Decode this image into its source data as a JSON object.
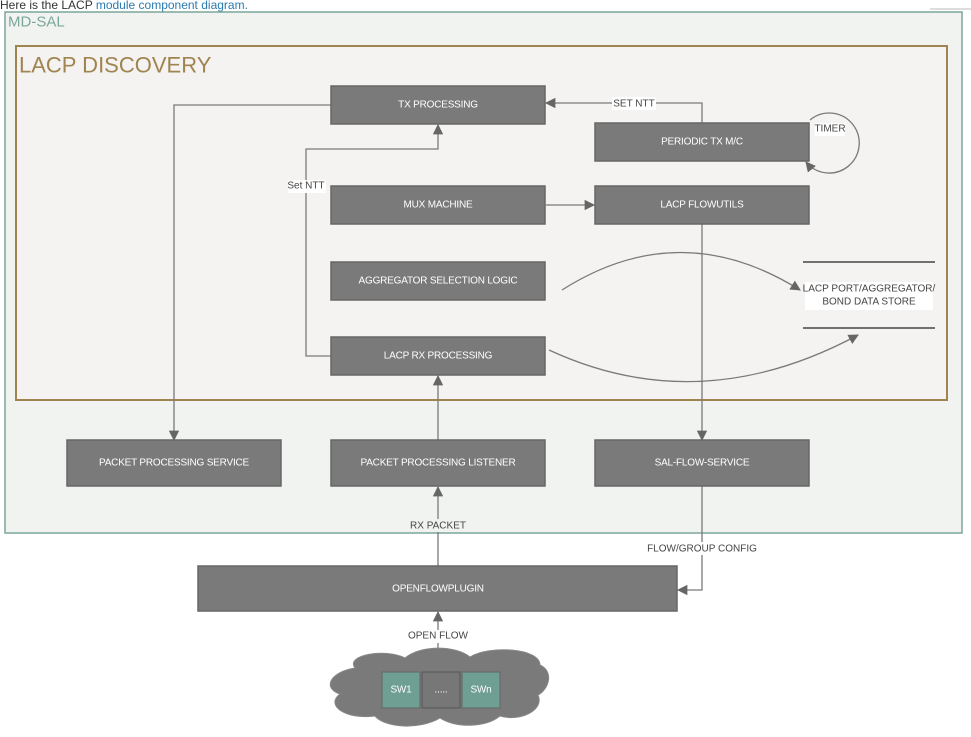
{
  "intro": {
    "prefix": "Here is the LACP ",
    "link": "module component diagram."
  },
  "containers": {
    "outer": "MD-SAL",
    "inner": "LACP DISCOVERY"
  },
  "boxes": {
    "tx": "TX PROCESSING",
    "periodic": "PERIODIC TX M/C",
    "mux": "MUX MACHINE",
    "flowutils": "LACP FLOWUTILS",
    "agg": "AGGREGATOR SELECTION LOGIC",
    "rx": "LACP RX PROCESSING",
    "pps": "PACKET PROCESSING SERVICE",
    "ppl": "PACKET PROCESSING LISTENER",
    "sal": "SAL-FLOW-SERVICE",
    "ofp": "OPENFLOWPLUGIN"
  },
  "datastore": {
    "line1": "LACP PORT/AGGREGATOR/",
    "line2": "BOND DATA STORE"
  },
  "labels": {
    "set_ntt_top": "SET NTT",
    "set_ntt_left": "Set NTT",
    "timer": "TIMER",
    "rx_packet": "RX PACKET",
    "flow_group": "FLOW/GROUP CONFIG",
    "open_flow": "OPEN FLOW"
  },
  "switches": [
    "SW1",
    ".....",
    "SWn"
  ],
  "colors": {
    "outer_border": "#7ba69b",
    "inner_border": "#a08450",
    "box": "#7a7a7a",
    "switch": "#6f9e92"
  }
}
